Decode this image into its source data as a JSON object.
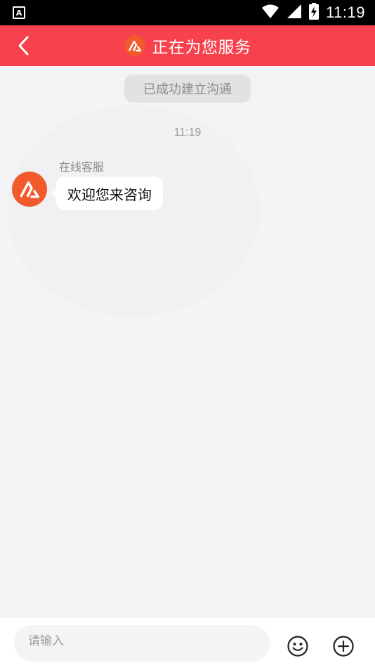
{
  "status_bar": {
    "app_icon_letter": "A",
    "time": "11:19",
    "icons": [
      "wifi-icon",
      "signal-icon",
      "battery-charging-icon"
    ]
  },
  "header": {
    "title": "正在为您服务",
    "back_icon": "chevron-left-icon",
    "logo_icon": "brand-logo-icon",
    "color": "#f7414c"
  },
  "chat": {
    "system_notice": "已成功建立沟通",
    "timestamp": "11:19",
    "messages": [
      {
        "sender": "在线客服",
        "avatar_icon": "brand-logo-icon",
        "text": "欢迎您来咨询"
      }
    ]
  },
  "input_bar": {
    "placeholder": "请输入",
    "value": "",
    "emoji_icon": "smile-icon",
    "add_icon": "plus-circle-icon"
  }
}
